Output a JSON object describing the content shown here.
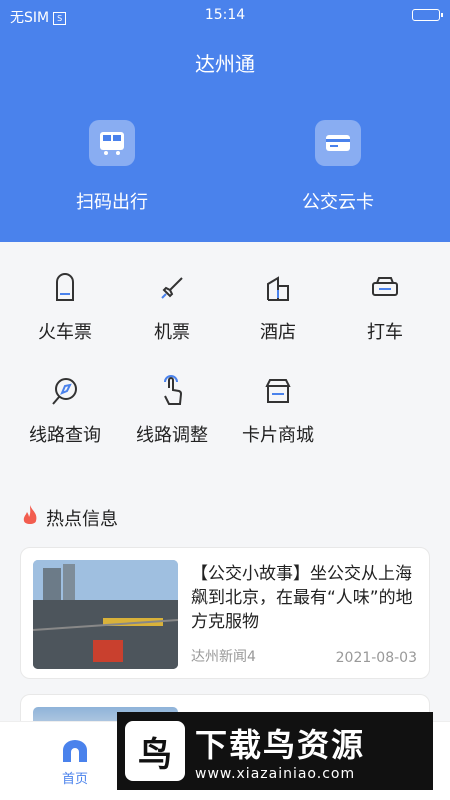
{
  "status": {
    "carrier": "无SIM",
    "sim_icon": "S",
    "time": "15:14"
  },
  "header": {
    "title": "达州通"
  },
  "top_actions": [
    {
      "label": "扫码出行",
      "icon": "bus-qr-icon"
    },
    {
      "label": "公交云卡",
      "icon": "card-icon"
    }
  ],
  "grid": [
    {
      "label": "火车票",
      "icon": "train-icon"
    },
    {
      "label": "机票",
      "icon": "rocket-plane-icon"
    },
    {
      "label": "酒店",
      "icon": "building-icon"
    },
    {
      "label": "打车",
      "icon": "car-icon"
    },
    {
      "label": "线路查询",
      "icon": "compass-search-icon"
    },
    {
      "label": "线路调整",
      "icon": "hand-touch-icon"
    },
    {
      "label": "卡片商城",
      "icon": "store-icon"
    }
  ],
  "section": {
    "title": "热点信息"
  },
  "news": [
    {
      "title": "【公交小故事】坐公交从上海飙到北京，在最有“人味”的地方克服物",
      "source": "达州新闻4",
      "date": "2021-08-03"
    }
  ],
  "tabbar": {
    "home_label": "首页"
  },
  "watermark": {
    "brand": "下载鸟资源",
    "url": "www.xiazainiao.com"
  },
  "colors": {
    "primary": "#4a82ec",
    "hot": "#f25d4f"
  }
}
